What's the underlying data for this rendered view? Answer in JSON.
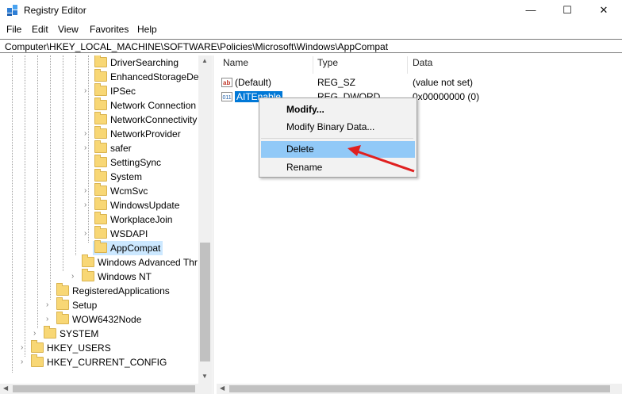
{
  "window": {
    "title": "Registry Editor",
    "minimize": "—",
    "maximize": "☐",
    "close": "✕"
  },
  "menu": [
    "File",
    "Edit",
    "View",
    "Favorites",
    "Help"
  ],
  "address": "Computer\\HKEY_LOCAL_MACHINE\\SOFTWARE\\Policies\\Microsoft\\Windows\\AppCompat",
  "tree": [
    {
      "label": "DriverSearching",
      "chevron": ""
    },
    {
      "label": "EnhancedStorageDev",
      "chevron": ""
    },
    {
      "label": "IPSec",
      "chevron": "›"
    },
    {
      "label": "Network Connection",
      "chevron": ""
    },
    {
      "label": "NetworkConnectivity",
      "chevron": ""
    },
    {
      "label": "NetworkProvider",
      "chevron": "›"
    },
    {
      "label": "safer",
      "chevron": "›"
    },
    {
      "label": "SettingSync",
      "chevron": ""
    },
    {
      "label": "System",
      "chevron": ""
    },
    {
      "label": "WcmSvc",
      "chevron": "›"
    },
    {
      "label": "WindowsUpdate",
      "chevron": "›"
    },
    {
      "label": "WorkplaceJoin",
      "chevron": ""
    },
    {
      "label": "WSDAPI",
      "chevron": "›"
    },
    {
      "label": "AppCompat",
      "chevron": ""
    },
    {
      "label": "Windows Advanced Thr",
      "chevron": ""
    },
    {
      "label": "Windows NT",
      "chevron": "›"
    },
    {
      "label": "RegisteredApplications",
      "chevron": ""
    },
    {
      "label": "Setup",
      "chevron": "›"
    },
    {
      "label": "WOW6432Node",
      "chevron": "›"
    },
    {
      "label": "SYSTEM",
      "chevron": "›"
    },
    {
      "label": "HKEY_USERS",
      "chevron": "›"
    },
    {
      "label": "HKEY_CURRENT_CONFIG",
      "chevron": "›"
    }
  ],
  "columns": {
    "name": "Name",
    "type": "Type",
    "data": "Data"
  },
  "values": [
    {
      "name": "(Default)",
      "type": "REG_SZ",
      "data": "(value not set)",
      "icon": "string-value-icon"
    },
    {
      "name": "AITEnable",
      "type": "REG_DWORD",
      "data": "0x00000000 (0)",
      "icon": "binary-value-icon"
    }
  ],
  "context_menu": {
    "items": [
      "Modify...",
      "Modify Binary Data...",
      "Delete",
      "Rename"
    ],
    "highlighted": "Delete"
  },
  "annotation": {
    "color": "#e02020",
    "target": "Delete"
  }
}
